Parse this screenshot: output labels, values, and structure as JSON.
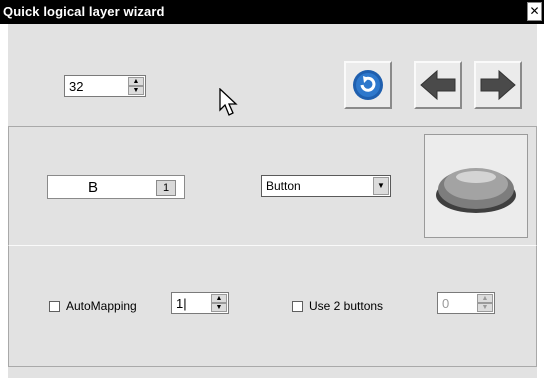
{
  "window": {
    "title": "Quick logical layer wizard",
    "close_label": "✕"
  },
  "top_spinner": {
    "value": "32"
  },
  "toolbar": {
    "refresh_icon": "refresh-icon",
    "back_icon": "arrow-left-icon",
    "forward_icon": "arrow-right-icon"
  },
  "key_panel": {
    "key_letter": "B",
    "key_index": "1",
    "type_value": "Button"
  },
  "bottom_panel": {
    "automapping_label": "AutoMapping",
    "automapping_value": "1|",
    "use2buttons_label": "Use 2 buttons",
    "use2buttons_value": "0"
  },
  "colors": {
    "accent_blue": "#1f5fae",
    "arrow_gray": "#4a4a4a",
    "window_bg": "#e2e2e2"
  }
}
